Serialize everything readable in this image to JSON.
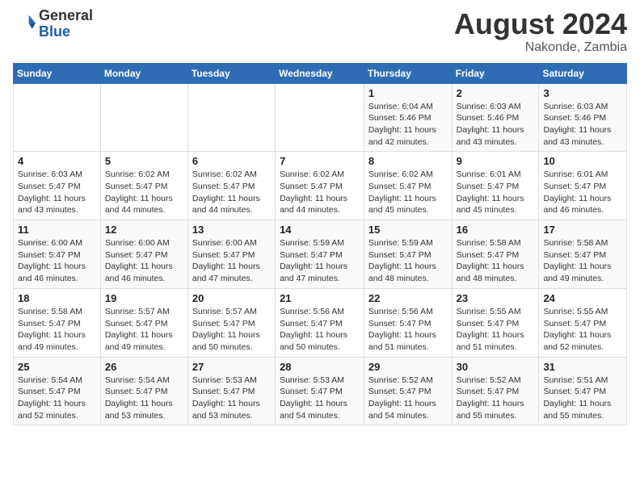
{
  "header": {
    "logo_general": "General",
    "logo_blue": "Blue",
    "main_title": "August 2024",
    "subtitle": "Nakonde, Zambia"
  },
  "calendar": {
    "weekdays": [
      "Sunday",
      "Monday",
      "Tuesday",
      "Wednesday",
      "Thursday",
      "Friday",
      "Saturday"
    ],
    "weeks": [
      [
        {
          "day": "",
          "info": ""
        },
        {
          "day": "",
          "info": ""
        },
        {
          "day": "",
          "info": ""
        },
        {
          "day": "",
          "info": ""
        },
        {
          "day": "1",
          "info": "Sunrise: 6:04 AM\nSunset: 5:46 PM\nDaylight: 11 hours\nand 42 minutes."
        },
        {
          "day": "2",
          "info": "Sunrise: 6:03 AM\nSunset: 5:46 PM\nDaylight: 11 hours\nand 43 minutes."
        },
        {
          "day": "3",
          "info": "Sunrise: 6:03 AM\nSunset: 5:46 PM\nDaylight: 11 hours\nand 43 minutes."
        }
      ],
      [
        {
          "day": "4",
          "info": "Sunrise: 6:03 AM\nSunset: 5:47 PM\nDaylight: 11 hours\nand 43 minutes."
        },
        {
          "day": "5",
          "info": "Sunrise: 6:02 AM\nSunset: 5:47 PM\nDaylight: 11 hours\nand 44 minutes."
        },
        {
          "day": "6",
          "info": "Sunrise: 6:02 AM\nSunset: 5:47 PM\nDaylight: 11 hours\nand 44 minutes."
        },
        {
          "day": "7",
          "info": "Sunrise: 6:02 AM\nSunset: 5:47 PM\nDaylight: 11 hours\nand 44 minutes."
        },
        {
          "day": "8",
          "info": "Sunrise: 6:02 AM\nSunset: 5:47 PM\nDaylight: 11 hours\nand 45 minutes."
        },
        {
          "day": "9",
          "info": "Sunrise: 6:01 AM\nSunset: 5:47 PM\nDaylight: 11 hours\nand 45 minutes."
        },
        {
          "day": "10",
          "info": "Sunrise: 6:01 AM\nSunset: 5:47 PM\nDaylight: 11 hours\nand 46 minutes."
        }
      ],
      [
        {
          "day": "11",
          "info": "Sunrise: 6:00 AM\nSunset: 5:47 PM\nDaylight: 11 hours\nand 46 minutes."
        },
        {
          "day": "12",
          "info": "Sunrise: 6:00 AM\nSunset: 5:47 PM\nDaylight: 11 hours\nand 46 minutes."
        },
        {
          "day": "13",
          "info": "Sunrise: 6:00 AM\nSunset: 5:47 PM\nDaylight: 11 hours\nand 47 minutes."
        },
        {
          "day": "14",
          "info": "Sunrise: 5:59 AM\nSunset: 5:47 PM\nDaylight: 11 hours\nand 47 minutes."
        },
        {
          "day": "15",
          "info": "Sunrise: 5:59 AM\nSunset: 5:47 PM\nDaylight: 11 hours\nand 48 minutes."
        },
        {
          "day": "16",
          "info": "Sunrise: 5:58 AM\nSunset: 5:47 PM\nDaylight: 11 hours\nand 48 minutes."
        },
        {
          "day": "17",
          "info": "Sunrise: 5:58 AM\nSunset: 5:47 PM\nDaylight: 11 hours\nand 49 minutes."
        }
      ],
      [
        {
          "day": "18",
          "info": "Sunrise: 5:58 AM\nSunset: 5:47 PM\nDaylight: 11 hours\nand 49 minutes."
        },
        {
          "day": "19",
          "info": "Sunrise: 5:57 AM\nSunset: 5:47 PM\nDaylight: 11 hours\nand 49 minutes."
        },
        {
          "day": "20",
          "info": "Sunrise: 5:57 AM\nSunset: 5:47 PM\nDaylight: 11 hours\nand 50 minutes."
        },
        {
          "day": "21",
          "info": "Sunrise: 5:56 AM\nSunset: 5:47 PM\nDaylight: 11 hours\nand 50 minutes."
        },
        {
          "day": "22",
          "info": "Sunrise: 5:56 AM\nSunset: 5:47 PM\nDaylight: 11 hours\nand 51 minutes."
        },
        {
          "day": "23",
          "info": "Sunrise: 5:55 AM\nSunset: 5:47 PM\nDaylight: 11 hours\nand 51 minutes."
        },
        {
          "day": "24",
          "info": "Sunrise: 5:55 AM\nSunset: 5:47 PM\nDaylight: 11 hours\nand 52 minutes."
        }
      ],
      [
        {
          "day": "25",
          "info": "Sunrise: 5:54 AM\nSunset: 5:47 PM\nDaylight: 11 hours\nand 52 minutes."
        },
        {
          "day": "26",
          "info": "Sunrise: 5:54 AM\nSunset: 5:47 PM\nDaylight: 11 hours\nand 53 minutes."
        },
        {
          "day": "27",
          "info": "Sunrise: 5:53 AM\nSunset: 5:47 PM\nDaylight: 11 hours\nand 53 minutes."
        },
        {
          "day": "28",
          "info": "Sunrise: 5:53 AM\nSunset: 5:47 PM\nDaylight: 11 hours\nand 54 minutes."
        },
        {
          "day": "29",
          "info": "Sunrise: 5:52 AM\nSunset: 5:47 PM\nDaylight: 11 hours\nand 54 minutes."
        },
        {
          "day": "30",
          "info": "Sunrise: 5:52 AM\nSunset: 5:47 PM\nDaylight: 11 hours\nand 55 minutes."
        },
        {
          "day": "31",
          "info": "Sunrise: 5:51 AM\nSunset: 5:47 PM\nDaylight: 11 hours\nand 55 minutes."
        }
      ]
    ]
  }
}
